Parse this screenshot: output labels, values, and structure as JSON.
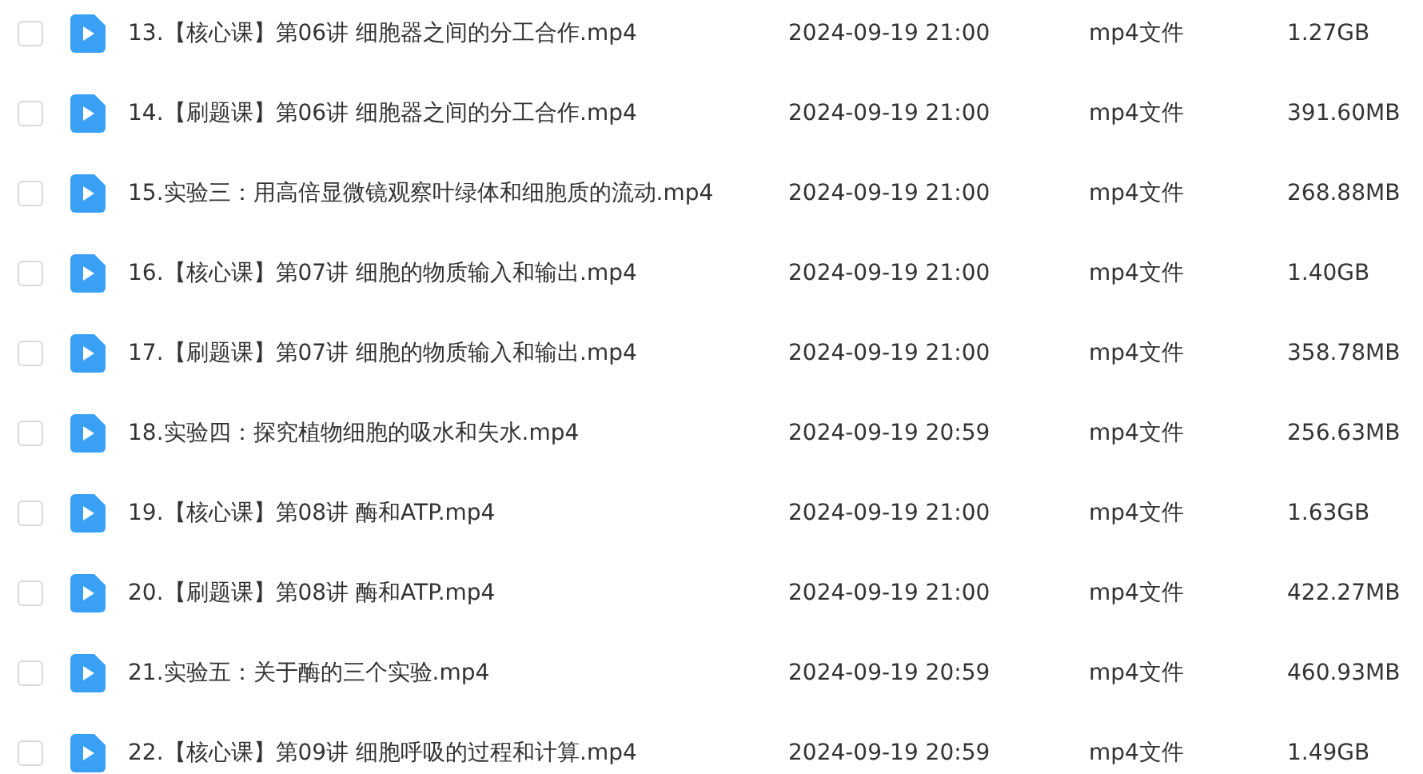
{
  "files": [
    {
      "name": "13.【核心课】第06讲 细胞器之间的分工合作.mp4",
      "modified": "2024-09-19 21:00",
      "type": "mp4文件",
      "size": "1.27GB",
      "checked": false
    },
    {
      "name": "14.【刷题课】第06讲 细胞器之间的分工合作.mp4",
      "modified": "2024-09-19 21:00",
      "type": "mp4文件",
      "size": "391.60MB",
      "checked": false
    },
    {
      "name": "15.实验三：用高倍显微镜观察叶绿体和细胞质的流动.mp4",
      "modified": "2024-09-19 21:00",
      "type": "mp4文件",
      "size": "268.88MB",
      "checked": false
    },
    {
      "name": "16.【核心课】第07讲 细胞的物质输入和输出.mp4",
      "modified": "2024-09-19 21:00",
      "type": "mp4文件",
      "size": "1.40GB",
      "checked": false
    },
    {
      "name": "17.【刷题课】第07讲 细胞的物质输入和输出.mp4",
      "modified": "2024-09-19 21:00",
      "type": "mp4文件",
      "size": "358.78MB",
      "checked": false
    },
    {
      "name": "18.实验四：探究植物细胞的吸水和失水.mp4",
      "modified": "2024-09-19 20:59",
      "type": "mp4文件",
      "size": "256.63MB",
      "checked": false
    },
    {
      "name": "19.【核心课】第08讲 酶和ATP.mp4",
      "modified": "2024-09-19 21:00",
      "type": "mp4文件",
      "size": "1.63GB",
      "checked": false
    },
    {
      "name": "20.【刷题课】第08讲 酶和ATP.mp4",
      "modified": "2024-09-19 21:00",
      "type": "mp4文件",
      "size": "422.27MB",
      "checked": false
    },
    {
      "name": "21.实验五：关于酶的三个实验.mp4",
      "modified": "2024-09-19 20:59",
      "type": "mp4文件",
      "size": "460.93MB",
      "checked": false
    },
    {
      "name": "22.【核心课】第09讲 细胞呼吸的过程和计算.mp4",
      "modified": "2024-09-19 20:59",
      "type": "mp4文件",
      "size": "1.49GB",
      "checked": false
    }
  ]
}
